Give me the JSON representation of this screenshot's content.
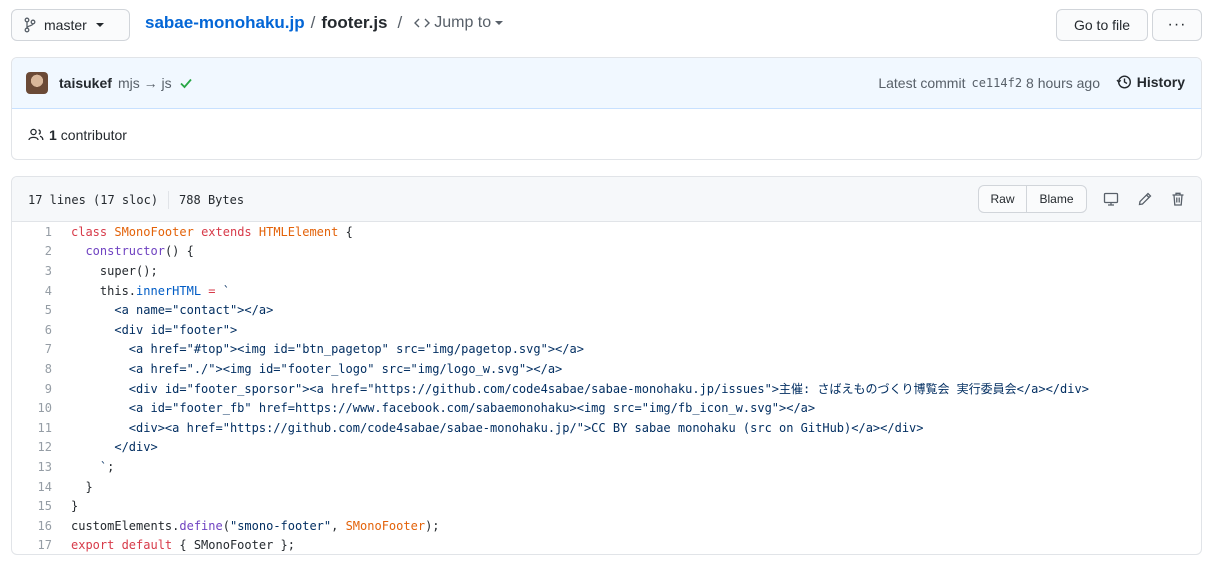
{
  "branch": {
    "name": "master"
  },
  "breadcrumb": {
    "repo": "sabae-monohaku.jp",
    "separator": "/",
    "file": "footer.js",
    "jump_label": "Jump to"
  },
  "actions": {
    "go_to_file": "Go to file",
    "more": "···"
  },
  "commit": {
    "author": "taisukef",
    "message": "mjs → js",
    "latest_label": "Latest commit",
    "sha": "ce114f2",
    "time": "8 hours ago",
    "history_label": "History"
  },
  "contributors": {
    "count": "1",
    "label": "contributor"
  },
  "file": {
    "lines_info": "17 lines (17 sloc)",
    "size": "788 Bytes",
    "raw_label": "Raw",
    "blame_label": "Blame"
  },
  "icons": [
    "branch-icon",
    "code-icon",
    "check-icon",
    "history-icon",
    "people-icon",
    "desktop-icon",
    "pencil-icon",
    "trash-icon"
  ],
  "colors": {
    "link": "#0366d6",
    "keyword": "#d73a49",
    "type": "#e36209",
    "function": "#6f42c1",
    "constant": "#005cc5",
    "string": "#032f62",
    "check": "#28a745"
  },
  "code_lines": [
    [
      [
        "k",
        "class "
      ],
      [
        "t",
        "SMonoFooter"
      ],
      [
        "k",
        " extends "
      ],
      [
        "t",
        "HTMLElement"
      ],
      [
        "p",
        " {"
      ]
    ],
    [
      [
        "p",
        "  "
      ],
      [
        "f",
        "constructor"
      ],
      [
        "p",
        "() {"
      ]
    ],
    [
      [
        "p",
        "    super();"
      ]
    ],
    [
      [
        "p",
        "    this."
      ],
      [
        "c",
        "innerHTML"
      ],
      [
        "k",
        " = "
      ],
      [
        "s",
        "`"
      ]
    ],
    [
      [
        "s",
        "      <a name=\"contact\"></a>"
      ]
    ],
    [
      [
        "s",
        "      <div id=\"footer\">"
      ]
    ],
    [
      [
        "s",
        "        <a href=\"#top\"><img id=\"btn_pagetop\" src=\"img/pagetop.svg\"></a>"
      ]
    ],
    [
      [
        "s",
        "        <a href=\"./\"><img id=\"footer_logo\" src=\"img/logo_w.svg\"></a>"
      ]
    ],
    [
      [
        "s",
        "        <div id=\"footer_sporsor\"><a href=\"https://github.com/code4sabae/sabae-monohaku.jp/issues\">主催: さばえものづくり博覧会 実行委員会</a></div>"
      ]
    ],
    [
      [
        "s",
        "        <a id=\"footer_fb\" href=https://www.facebook.com/sabaemonohaku><img src=\"img/fb_icon_w.svg\"></a>"
      ]
    ],
    [
      [
        "s",
        "        <div><a href=\"https://github.com/code4sabae/sabae-monohaku.jp/\">CC BY sabae monohaku (src on GitHub)</a></div>"
      ]
    ],
    [
      [
        "s",
        "      </div>"
      ]
    ],
    [
      [
        "s",
        "    `"
      ],
      [
        "p",
        ";"
      ]
    ],
    [
      [
        "p",
        "  }"
      ]
    ],
    [
      [
        "p",
        "}"
      ]
    ],
    [
      [
        "p",
        "customElements."
      ],
      [
        "f",
        "define"
      ],
      [
        "p",
        "("
      ],
      [
        "s",
        "\"smono-footer\""
      ],
      [
        "p",
        ", "
      ],
      [
        "t",
        "SMonoFooter"
      ],
      [
        "p",
        ");"
      ]
    ],
    [
      [
        "k",
        "export default"
      ],
      [
        "p",
        " { SMonoFooter };"
      ]
    ]
  ]
}
